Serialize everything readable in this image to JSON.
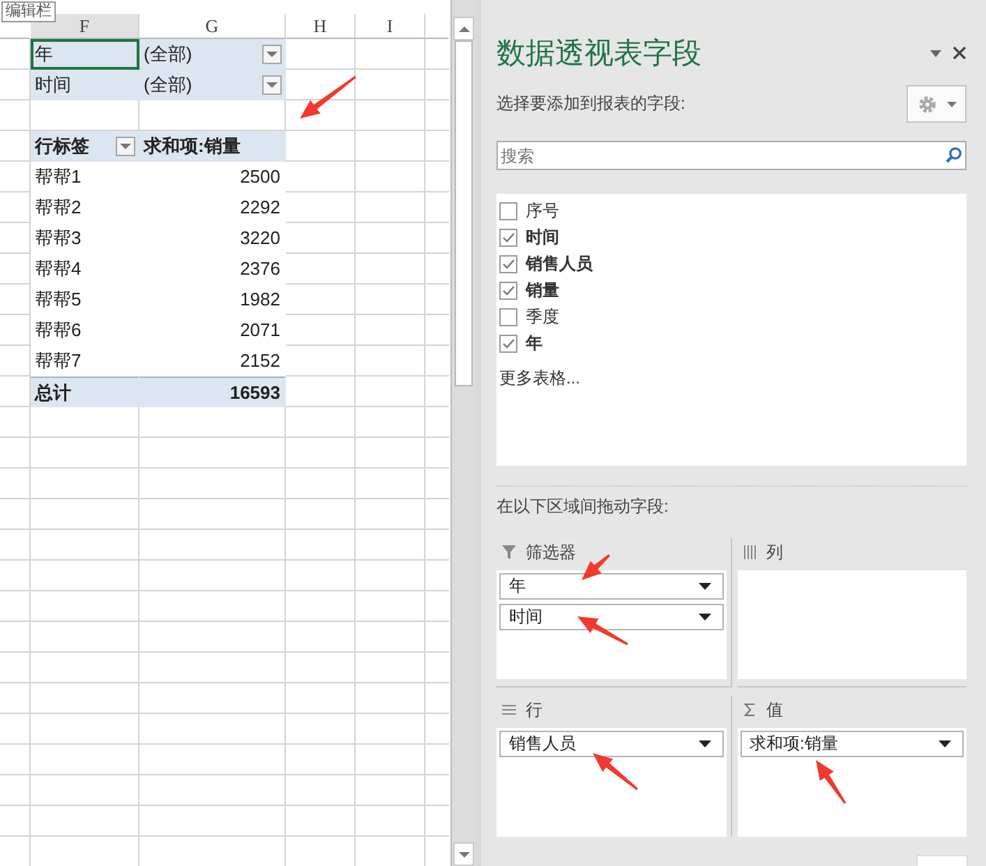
{
  "tooltip": "编辑栏",
  "sheet": {
    "columns": [
      "F",
      "G",
      "H",
      "I"
    ],
    "filters": [
      {
        "field": "年",
        "value": "(全部)",
        "selected": true
      },
      {
        "field": "时间",
        "value": "(全部)",
        "selected": false
      }
    ],
    "pivot": {
      "header_label": "行标签",
      "header_value": "求和项:销量",
      "rows": [
        {
          "label": "帮帮1",
          "value": "2500"
        },
        {
          "label": "帮帮2",
          "value": "2292"
        },
        {
          "label": "帮帮3",
          "value": "3220"
        },
        {
          "label": "帮帮4",
          "value": "2376"
        },
        {
          "label": "帮帮5",
          "value": "1982"
        },
        {
          "label": "帮帮6",
          "value": "2071"
        },
        {
          "label": "帮帮7",
          "value": "2152"
        }
      ],
      "total": {
        "label": "总计",
        "value": "16593"
      }
    }
  },
  "panel": {
    "title": "数据透视表字段",
    "subtitle": "选择要添加到报表的字段:",
    "search": {
      "placeholder": "搜索"
    },
    "fields": [
      {
        "label": "序号",
        "checked": false
      },
      {
        "label": "时间",
        "checked": true
      },
      {
        "label": "销售人员",
        "checked": true
      },
      {
        "label": "销量",
        "checked": true
      },
      {
        "label": "季度",
        "checked": false
      },
      {
        "label": "年",
        "checked": true
      }
    ],
    "more_link": "更多表格...",
    "areas_hint": "在以下区域间拖动字段:",
    "areas": [
      {
        "kind": "filters",
        "label": "筛选器",
        "items": [
          "年",
          "时间"
        ]
      },
      {
        "kind": "columns",
        "label": "列"
      },
      {
        "kind": "rows",
        "label": "行",
        "items": [
          "销售人员"
        ]
      },
      {
        "kind": "values",
        "label": "值",
        "items": [
          "求和项:销量"
        ]
      }
    ]
  }
}
